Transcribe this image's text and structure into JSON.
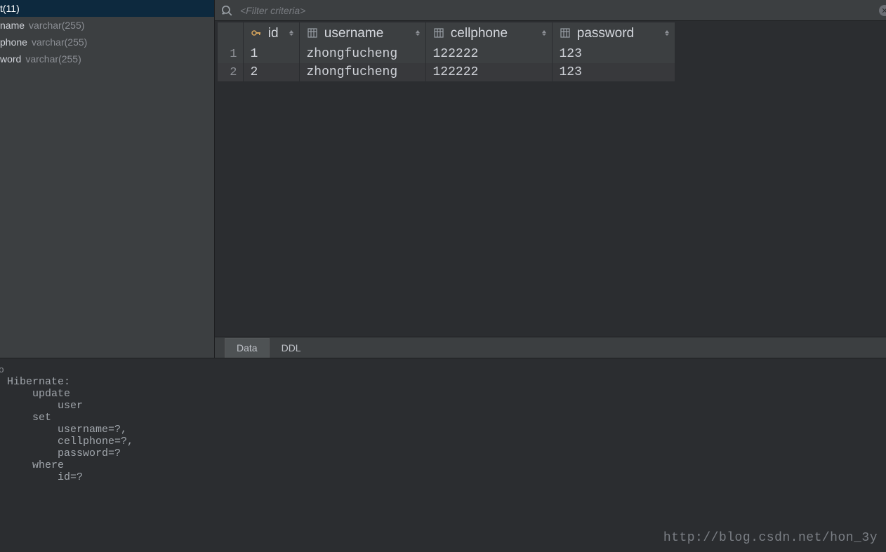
{
  "sidebar": {
    "columns": [
      {
        "name_fragment": "t(11)",
        "type": "",
        "selected": true
      },
      {
        "name_fragment": "name",
        "type": "varchar(255)",
        "selected": false
      },
      {
        "name_fragment": "phone",
        "type": "varchar(255)",
        "selected": false
      },
      {
        "name_fragment": "word",
        "type": "varchar(255)",
        "selected": false
      }
    ]
  },
  "filter": {
    "placeholder": "<Filter criteria>"
  },
  "table": {
    "headers": [
      "id",
      "username",
      "cellphone",
      "password"
    ],
    "rows": [
      {
        "num": "1",
        "id": "1",
        "username": "zhongfucheng",
        "cellphone": "122222",
        "password": "123"
      },
      {
        "num": "2",
        "id": "2",
        "username": "zhongfucheng",
        "cellphone": "122222",
        "password": "123"
      }
    ]
  },
  "tabs": {
    "data": "Data",
    "ddl": "DDL"
  },
  "console": {
    "text": "Hibernate: \n    update\n        user \n    set\n        username=?,\n        cellphone=?,\n        password=? \n    where\n        id=?"
  },
  "watermark": "http://blog.csdn.net/hon_3y",
  "marker": "o"
}
